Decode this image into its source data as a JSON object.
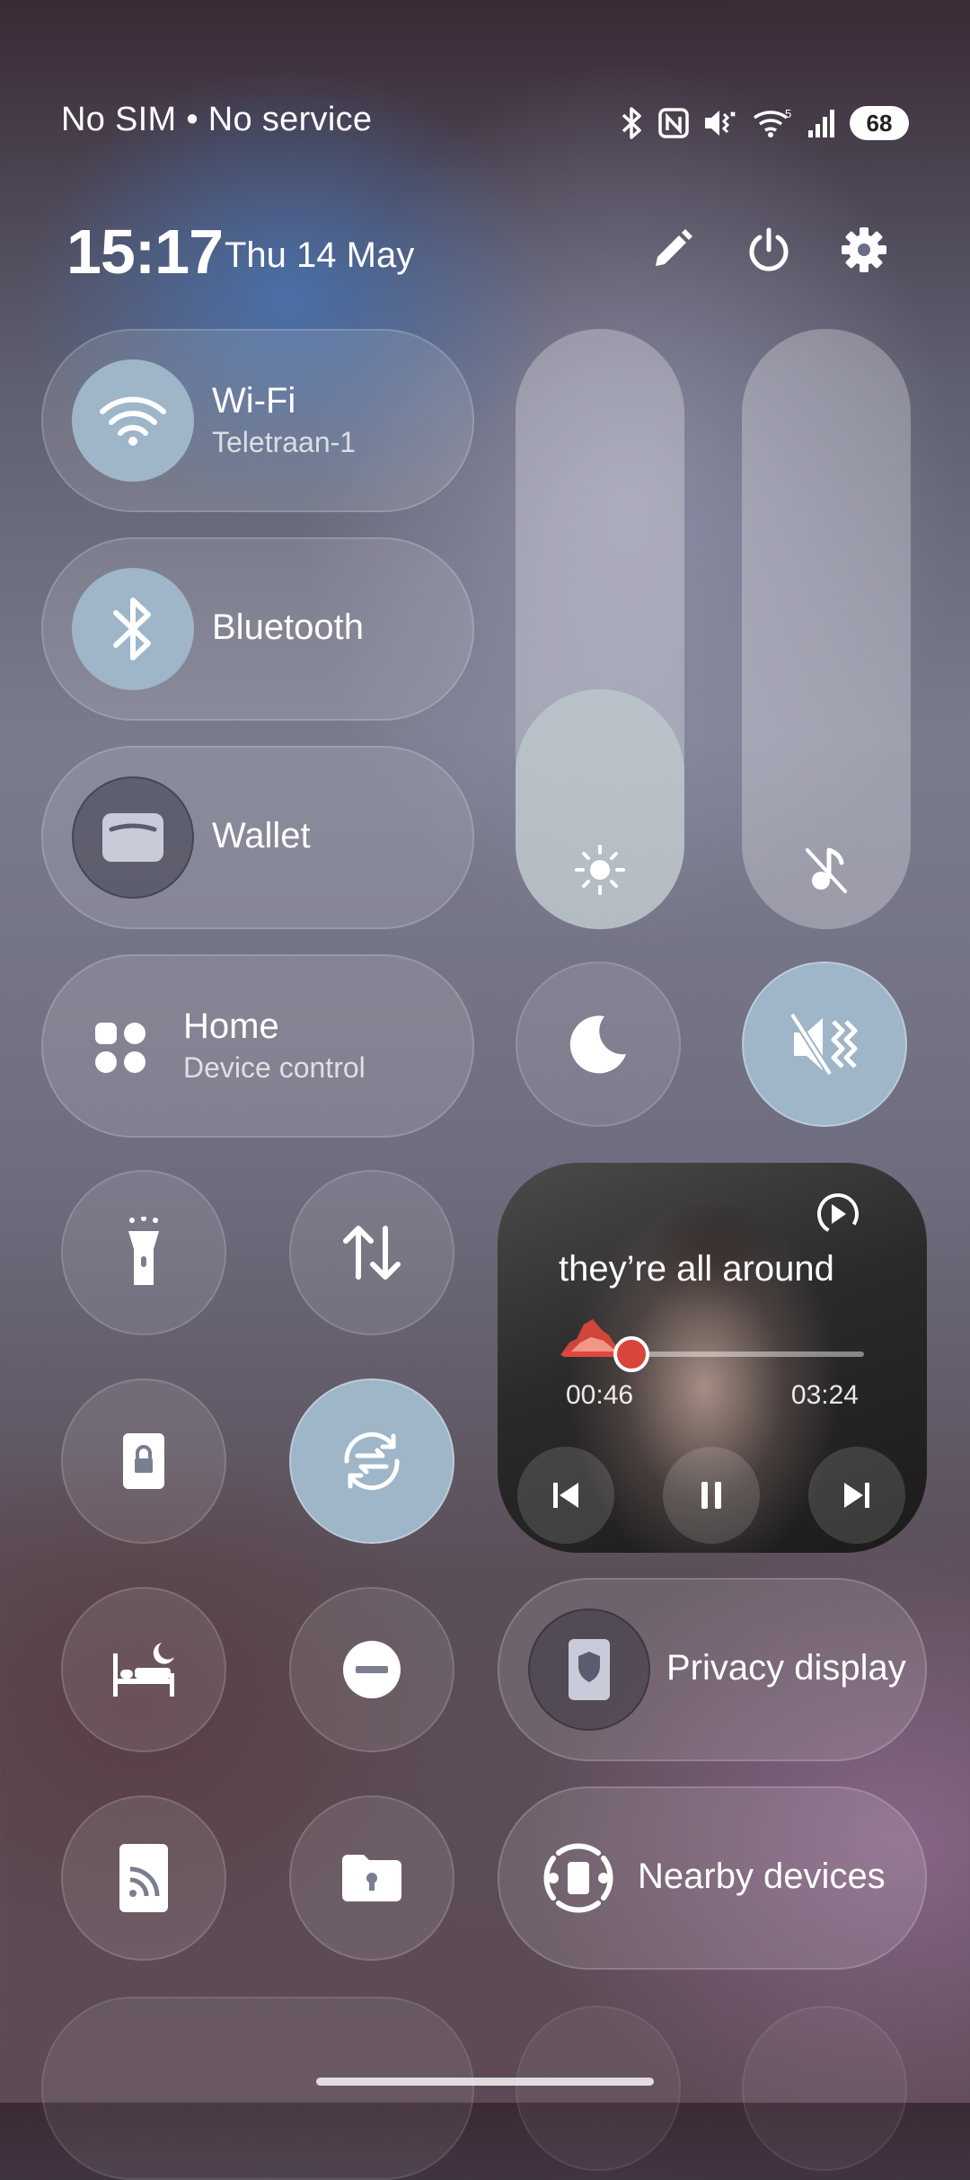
{
  "status_bar": {
    "carrier": "No SIM • No service",
    "icons": [
      "bluetooth-icon",
      "nfc-icon",
      "vibrate-mute-icon",
      "wifi-icon",
      "signal-icon"
    ],
    "battery": "68"
  },
  "header": {
    "time": "15:17",
    "date": "Thu 14 May",
    "buttons": [
      "edit-icon",
      "power-icon",
      "settings-icon"
    ]
  },
  "tiles": {
    "wifi": {
      "label": "Wi-Fi",
      "sub": "Teletraan-1",
      "active": true
    },
    "bluetooth": {
      "label": "Bluetooth",
      "active": true
    },
    "wallet": {
      "label": "Wallet",
      "active": false
    },
    "home": {
      "label": "Home",
      "sub": "Device control"
    },
    "privacy": {
      "label": "Privacy display"
    },
    "nearby": {
      "label": "Nearby devices"
    }
  },
  "sliders": {
    "brightness": {
      "level": 0.27,
      "icon": "sun-icon"
    },
    "volume": {
      "level": 0.0,
      "icon": "music-off-icon"
    }
  },
  "quick_toggles": [
    "moon-icon",
    "sound-mute-icon",
    "flashlight-icon",
    "data-transfer-icon",
    "lock-screen-icon",
    "auto-rotate-icon",
    "bedtime-icon",
    "do-not-disturb-icon",
    "cast-icon",
    "private-folder-icon"
  ],
  "media": {
    "title": "they’re all around",
    "elapsed": "00:46",
    "duration": "03:24",
    "progress": 0.23
  },
  "colors": {
    "accent": "#9fb5c8",
    "progress": "#e0483c"
  }
}
